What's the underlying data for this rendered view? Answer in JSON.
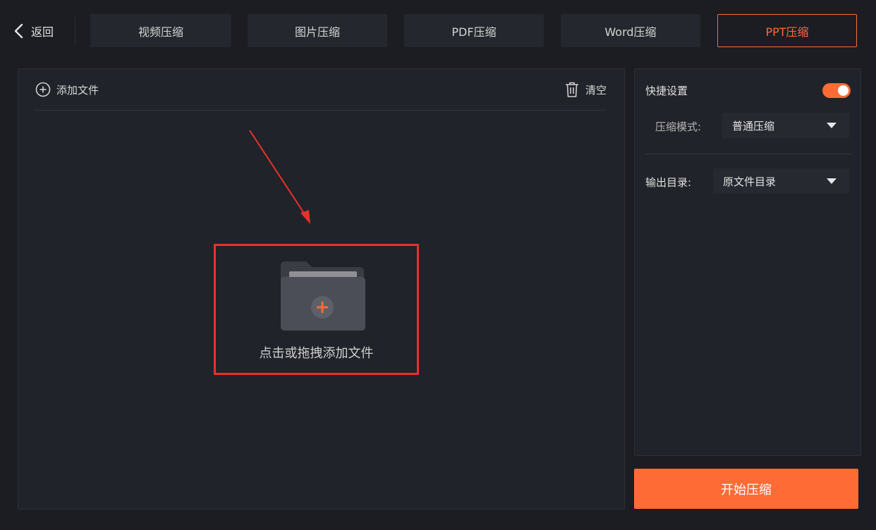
{
  "header": {
    "back_label": "返回",
    "tabs": [
      {
        "label": "视频压缩",
        "active": false
      },
      {
        "label": "图片压缩",
        "active": false
      },
      {
        "label": "PDF压缩",
        "active": false
      },
      {
        "label": "Word压缩",
        "active": false
      },
      {
        "label": "PPT压缩",
        "active": true
      }
    ]
  },
  "file_panel": {
    "add_file_label": "添加文件",
    "clear_label": "清空",
    "drop_text": "点击或拖拽添加文件"
  },
  "settings": {
    "quick_settings_label": "快捷设置",
    "quick_settings_enabled": true,
    "mode_label": "压缩模式:",
    "mode_value": "普通压缩",
    "output_label": "输出目录:",
    "output_value": "原文件目录"
  },
  "start_button_label": "开始压缩",
  "colors": {
    "accent": "#ff6b35",
    "background": "#1b1d22",
    "panel": "#202329",
    "annotation_red": "#e8312a"
  },
  "icons": {
    "back": "chevron-left-icon",
    "add": "plus-circle-icon",
    "clear": "trash-icon",
    "folder": "folder-plus-icon",
    "dropdown": "caret-down-icon"
  }
}
